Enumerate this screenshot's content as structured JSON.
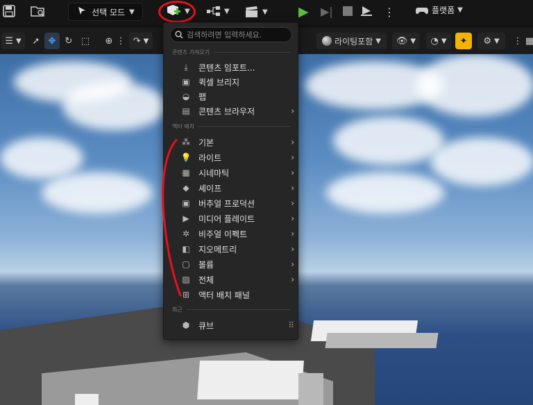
{
  "toolbar": {
    "mode_label": "선택 모드",
    "platform_label": "플랫폼"
  },
  "viewport_toolbar": {
    "lighting_label": "라이팅포함"
  },
  "menu": {
    "search_placeholder": "검색하려면 입력하세요.",
    "sections": {
      "content_import": "콘텐츠 가져오기",
      "actor_placement": "액터 배치",
      "recent": "최근"
    },
    "content_items": [
      {
        "label": "콘텐츠 임포트...",
        "icon": "import-icon",
        "has_submenu": false
      },
      {
        "label": "퀵셀 브리지",
        "icon": "quixel-bridge-icon",
        "has_submenu": false
      },
      {
        "label": "팹",
        "icon": "fab-icon",
        "has_submenu": false
      },
      {
        "label": "콘텐츠 브라우저",
        "icon": "content-browser-icon",
        "has_submenu": true
      }
    ],
    "actor_items": [
      {
        "label": "기본",
        "icon": "basic-icon",
        "has_submenu": true
      },
      {
        "label": "라이트",
        "icon": "light-icon",
        "has_submenu": true
      },
      {
        "label": "시네마틱",
        "icon": "cinematic-icon",
        "has_submenu": true
      },
      {
        "label": "셰이프",
        "icon": "shapes-icon",
        "has_submenu": true
      },
      {
        "label": "버추얼 프로덕션",
        "icon": "virtual-production-icon",
        "has_submenu": true
      },
      {
        "label": "미디어 플레이트",
        "icon": "media-plate-icon",
        "has_submenu": true
      },
      {
        "label": "비주얼 이펙트",
        "icon": "visual-effects-icon",
        "has_submenu": true
      },
      {
        "label": "지오메트리",
        "icon": "geometry-icon",
        "has_submenu": true
      },
      {
        "label": "볼륨",
        "icon": "volume-icon",
        "has_submenu": true
      },
      {
        "label": "전체",
        "icon": "all-classes-icon",
        "has_submenu": true
      },
      {
        "label": "액터 배치 패널",
        "icon": "place-actors-panel-icon",
        "has_submenu": false
      }
    ],
    "recent_items": [
      {
        "label": "큐브",
        "icon": "cube-icon"
      }
    ]
  },
  "annotation_color": "#e3121c",
  "accent_color": "#f2b400",
  "play_color": "#5fbf3a"
}
